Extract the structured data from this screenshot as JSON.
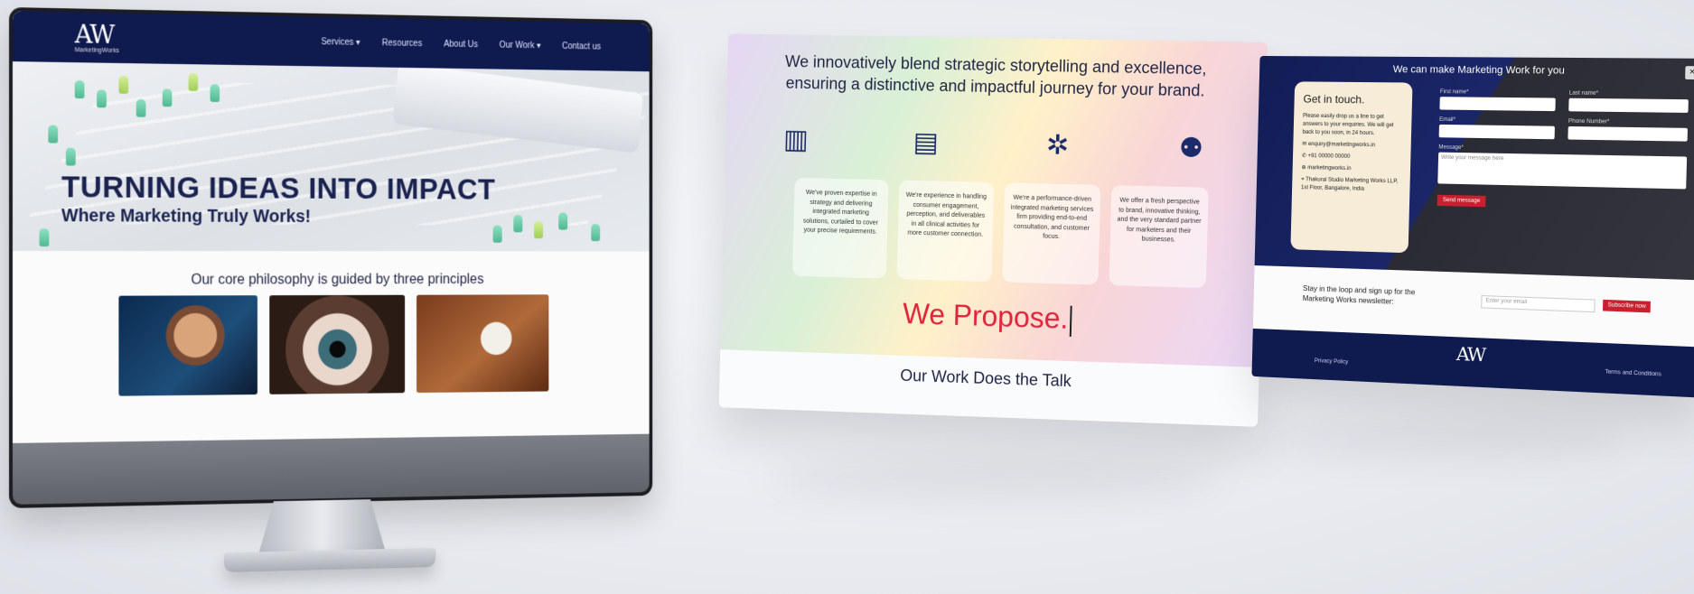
{
  "monitor": {
    "logo": "AW",
    "logo_sub": "MarketingWorks",
    "nav": [
      "Services ▾",
      "Resources",
      "About Us",
      "Our Work ▾",
      "Contact us"
    ],
    "hero_title": "TURNING IDEAS INTO IMPACT",
    "hero_subtitle": "Where Marketing Truly Works!",
    "philosophy": "Our core philosophy is guided by three principles"
  },
  "panel2": {
    "heading_line1": "We innovatively blend strategic storytelling and excellence,",
    "heading_line2": "ensuring a distinctive and impactful journey for your brand.",
    "icons": [
      "bar-chart-icon",
      "checklist-icon",
      "network-icon",
      "team-icon"
    ],
    "cards": [
      "We've proven expertise in strategy and delivering integrated marketing solutions, curtailed to cover your precise requirements.",
      "We're experience in handling consumer engagement, perception, and deliverables in all clinical activities for more customer connection.",
      "We're a performance-driven integrated marketing services firm providing end-to-end consultation, and customer focus.",
      "We offer a fresh perspective to brand, innovative thinking, and the very standard partner for marketers and their businesses."
    ],
    "propose": "We Propose.",
    "work_title": "Our Work Does the Talk"
  },
  "panel3": {
    "title": "We can make Marketing Work for you",
    "close": "×",
    "touch_title": "Get in touch.",
    "touch_text": "Please easily drop us a line to get answers to your enquiries. We will get back to you soon, in 24 hours.",
    "email": "enquiry@marketingworks.in",
    "phone": "+91 00000 00000",
    "web": "marketingworks.in",
    "address": "Thakural Studio Marketing Works LLP, 1st Floor, Bangalore, India",
    "form": {
      "label_first": "First name*",
      "label_last": "Last name*",
      "label_email": "Email*",
      "label_phone": "Phone Number*",
      "label_message": "Message*",
      "message_placeholder": "Write your message here",
      "send": "Send message"
    },
    "newsletter_text": "Stay in the loop and sign up for the Marketing Works newsletter:",
    "newsletter_placeholder": "Enter your email",
    "subscribe": "Subscribe now",
    "footer_logo": "AW",
    "footer_left": "Privacy Policy",
    "footer_right": "Terms and Conditions"
  }
}
